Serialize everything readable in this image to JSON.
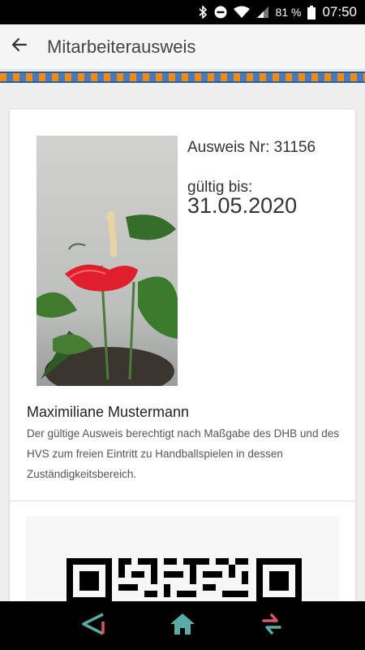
{
  "status_bar": {
    "battery": "81 %",
    "time": "07:50"
  },
  "app_bar": {
    "title": "Mitarbeiterausweis"
  },
  "card": {
    "id_number": "Ausweis Nr: 31156",
    "valid_label": "gültig bis:",
    "valid_date": "31.05.2020",
    "name": "Maximiliane Mustermann",
    "description": "Der gültige Ausweis berechtigt nach Maßgabe des DHB und des HVS zum freien Eintritt zu Handballspielen in dessen Zuständigkeitsbereich."
  },
  "colors": {
    "stripe_orange": "#f08a1c",
    "stripe_blue": "#4a7ab8",
    "nav_teal": "#5aaba6",
    "nav_pink": "#d9556f"
  },
  "icons": {
    "status": [
      "bluetooth-icon",
      "do-not-disturb-icon",
      "wifi-icon",
      "signal-icon",
      "battery-icon"
    ],
    "nav": [
      "back-nav-icon",
      "home-nav-icon",
      "switch-app-icon"
    ]
  }
}
